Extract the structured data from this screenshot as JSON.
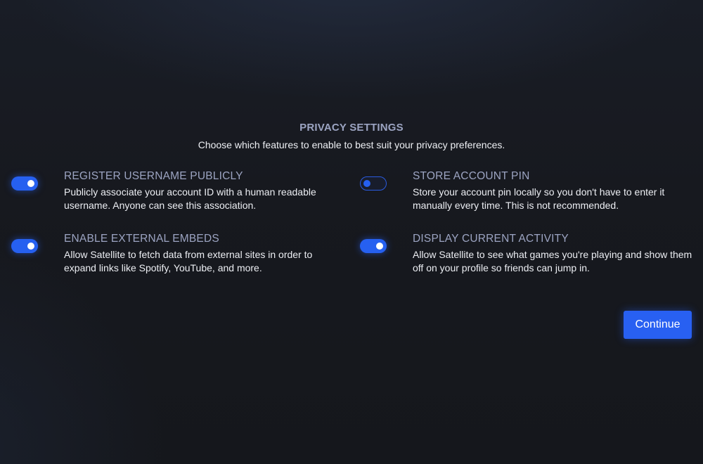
{
  "header": {
    "title": "PRIVACY SETTINGS",
    "subtitle": "Choose which features to enable to best suit your privacy preferences."
  },
  "settings": [
    {
      "title": "REGISTER USERNAME PUBLICLY",
      "description": "Publicly associate your account ID with a human readable username. Anyone can see this association.",
      "enabled": true
    },
    {
      "title": "STORE ACCOUNT PIN",
      "description": "Store your account pin locally so you don't have to enter it manually every time. This is not recommended.",
      "enabled": false
    },
    {
      "title": "ENABLE EXTERNAL EMBEDS",
      "description": "Allow Satellite to fetch data from external sites in order to expand links like Spotify, YouTube, and more.",
      "enabled": true
    },
    {
      "title": "DISPLAY CURRENT ACTIVITY",
      "description": "Allow Satellite to see what games you're playing and show them off on your profile so friends can jump in.",
      "enabled": true
    }
  ],
  "continue_label": "Continue",
  "colors": {
    "accent": "#2660f0",
    "title_muted": "#9ca4c2",
    "background": "#17191f"
  }
}
